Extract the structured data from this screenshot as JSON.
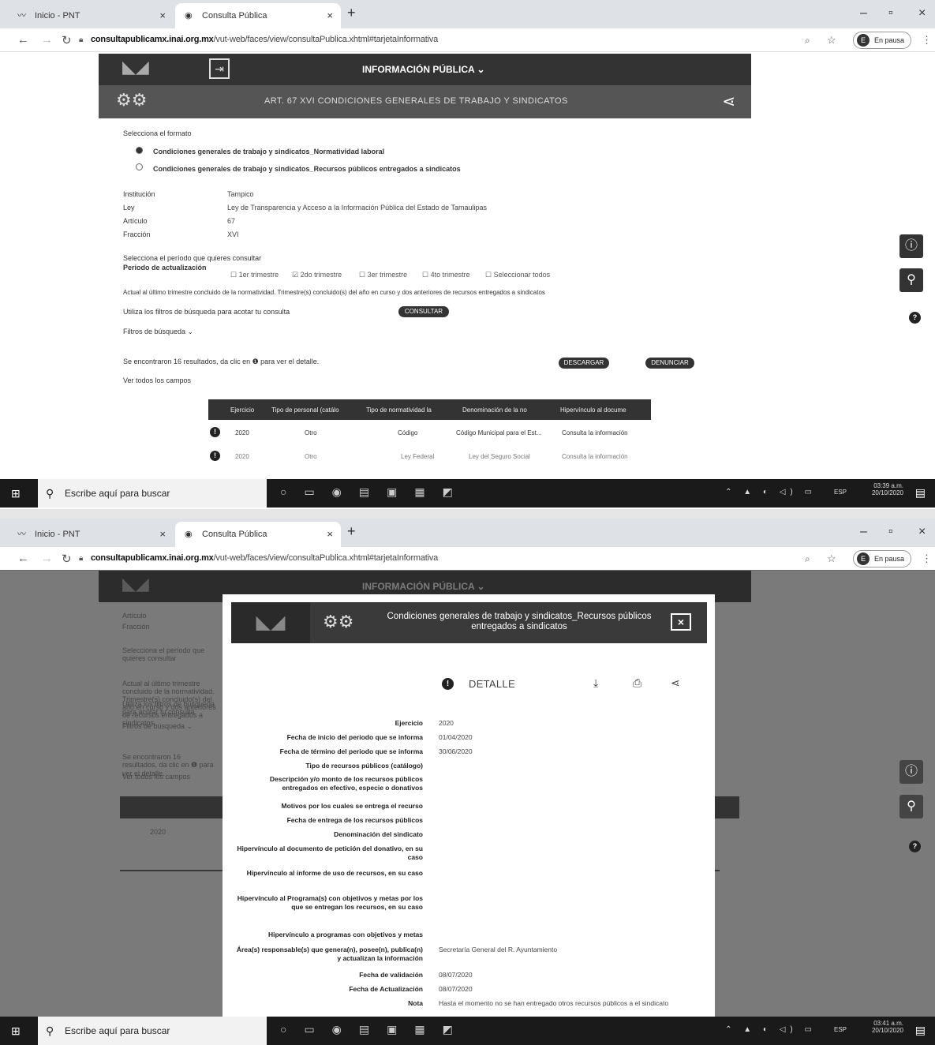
{
  "browser": {
    "tabs": [
      {
        "label": "Inicio - PNT"
      },
      {
        "label": "Consulta Pública"
      }
    ],
    "url_domain": "consultapublicamx.inai.org.mx",
    "url_path": "/vut-web/faces/view/consultaPublica.xhtml#tarjetaInformativa",
    "profile_label": "En pausa",
    "profile_initial": "E"
  },
  "site": {
    "menu_label": "INFORMACIÓN PÚBLICA ⌄",
    "article_title": "ART. 67 XVI CONDICIONES GENERALES DE TRABAJO Y SINDICATOS"
  },
  "form": {
    "format_prompt": "Selecciona el formato",
    "formats": [
      "Condiciones generales de trabajo y sindicatos_Normatividad laboral",
      "Condiciones generales de trabajo y sindicatos_Recursos públicos entregados a sindicatos"
    ],
    "meta": [
      {
        "label": "Institución",
        "value": "Tampico"
      },
      {
        "label": "Ley",
        "value": "Ley de Transparencia y Acceso a la Información Pública del Estado de Tamaulipas"
      },
      {
        "label": "Artículo",
        "value": "67"
      },
      {
        "label": "Fracción",
        "value": "XVI"
      }
    ],
    "period_prompt": "Selecciona el período que quieres consultar",
    "period_label": "Periodo de actualización",
    "periods": [
      "1er trimestre",
      "2do trimestre",
      "3er trimestre",
      "4to trimestre",
      "Seleccionar todos"
    ],
    "update_note": "Actual al último trimestre concluido de la normatividad. Trimestre(s) concluido(s) del año en curso y dos anteriores de recursos entregados a sindicatos",
    "filters_hint": "Utiliza los filtros de búsqueda para acotar tu consulta",
    "consult_btn": "CONSULTAR",
    "filters_toggle": "Filtros de búsqueda ⌄",
    "results_text": "Se encontraron 16 resultados, da clic en ❶ para ver el detalle.",
    "download_btn": "DESCARGAR",
    "denounce_btn": "DENUNCIAR",
    "all_fields": "Ver todos los campos"
  },
  "table": {
    "headers": [
      "Ejercicio",
      "Tipo de personal (catálo",
      "Tipo de normatividad la",
      "Denominación de la no",
      "Hipervínculo al docume"
    ],
    "rows": [
      [
        "2020",
        "Otro",
        "Código",
        "Código Municipal para el Est...",
        "Consulta la información"
      ],
      [
        "2020",
        "Otro",
        "Ley Federal",
        "Ley del Seguro Social",
        "Consulta la información"
      ]
    ]
  },
  "taskbar": {
    "search_placeholder": "Escribe aquí para buscar",
    "lang": "ESP",
    "time1": "03:39 a.m.",
    "date1": "20/10/2020",
    "time2": "03:41 a.m.",
    "date2": "20/10/2020"
  },
  "modal": {
    "title": "Condiciones generales de trabajo y sindicatos_Recursos públicos entregados a sindicatos",
    "detail_label": "DETALLE",
    "fields": [
      {
        "label": "Ejercicio",
        "value": "2020"
      },
      {
        "label": "Fecha de inicio del periodo que se informa",
        "value": "01/04/2020"
      },
      {
        "label": "Fecha de término del periodo que se informa",
        "value": "30/06/2020"
      },
      {
        "label": "Tipo de recursos públicos (catálogo)",
        "value": ""
      },
      {
        "label": "Descripción y/o monto de los recursos públicos entregados en efectivo, especie o donativos",
        "value": ""
      },
      {
        "label": "Motivos por los cuales se entrega el recurso",
        "value": ""
      },
      {
        "label": "Fecha de entrega de los recursos públicos",
        "value": ""
      },
      {
        "label": "Denominación del sindicato",
        "value": ""
      },
      {
        "label": "Hipervínculo al documento de petición del donativo, en su caso",
        "value": ""
      },
      {
        "label": "Hipervínculo al informe de uso de recursos, en su caso",
        "value": ""
      },
      {
        "label": "Hipervínculo al Programa(s) con objetivos y metas por los que se entregan los recursos, en su caso",
        "value": ""
      },
      {
        "label": "Hipervínculo a programas con objetivos y metas",
        "value": ""
      },
      {
        "label": "Área(s) responsable(s) que genera(n), posee(n), publica(n) y actualizan la información",
        "value": "Secretaría General del R. Ayuntamiento"
      },
      {
        "label": "Fecha de validación",
        "value": "08/07/2020"
      },
      {
        "label": "Fecha de Actualización",
        "value": "08/07/2020"
      },
      {
        "label": "Nota",
        "value": "Hasta el momento no se han entregado otros recursos públicos a el sindicato"
      }
    ]
  }
}
